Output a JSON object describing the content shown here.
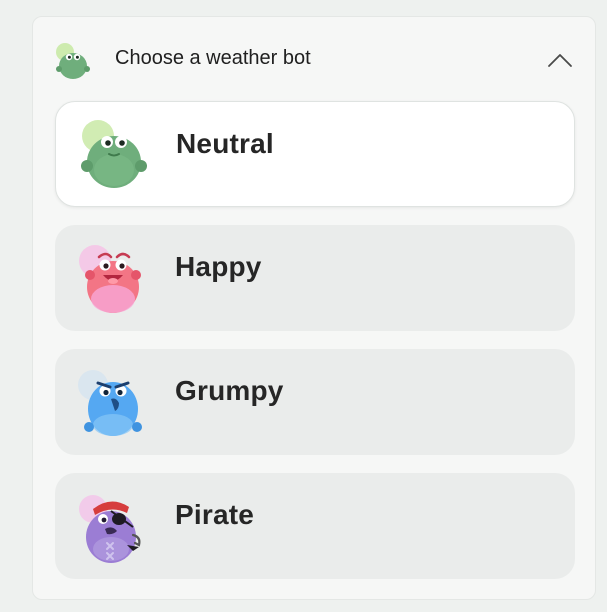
{
  "header": {
    "title": "Choose a weather bot",
    "avatar_icon": "neutral-bot-avatar",
    "chevron_icon": "chevron-up-icon"
  },
  "options": [
    {
      "label": "Neutral",
      "icon": "neutral-bot-icon",
      "selected": true,
      "color": "#6fae7c"
    },
    {
      "label": "Happy",
      "icon": "happy-bot-icon",
      "selected": false,
      "color": "#f26a7a"
    },
    {
      "label": "Grumpy",
      "icon": "grumpy-bot-icon",
      "selected": false,
      "color": "#55a8f2"
    },
    {
      "label": "Pirate",
      "icon": "pirate-bot-icon",
      "selected": false,
      "color": "#9b7dd4"
    }
  ],
  "colors": {
    "panel_bg": "#f6f7f6",
    "selected_bg": "#ffffff",
    "unselected_bg": "#eaeceb",
    "text": "#262626"
  }
}
